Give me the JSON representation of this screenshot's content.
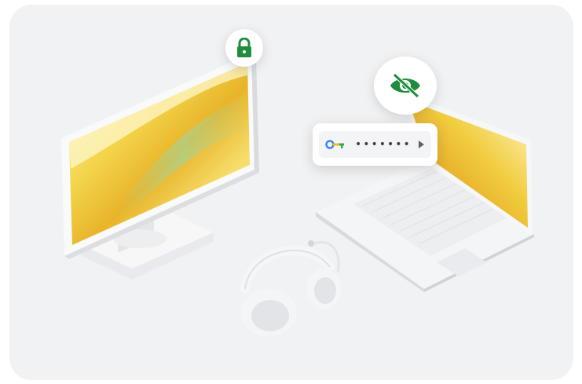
{
  "password_field": {
    "masked_value": "•••••••",
    "icons": {
      "key": "key-icon",
      "reveal": "play-arrow-icon"
    }
  },
  "badges": {
    "secure": "lock-icon",
    "hidden": "eye-off-icon"
  },
  "colors": {
    "accent_green": "#1e8e3e",
    "google_blue": "#4285f4",
    "google_yellow": "#fbbc04",
    "google_green": "#34a853",
    "card_bg": "#f1f2f4"
  },
  "devices": [
    "desktop-monitor",
    "laptop",
    "headphones"
  ]
}
